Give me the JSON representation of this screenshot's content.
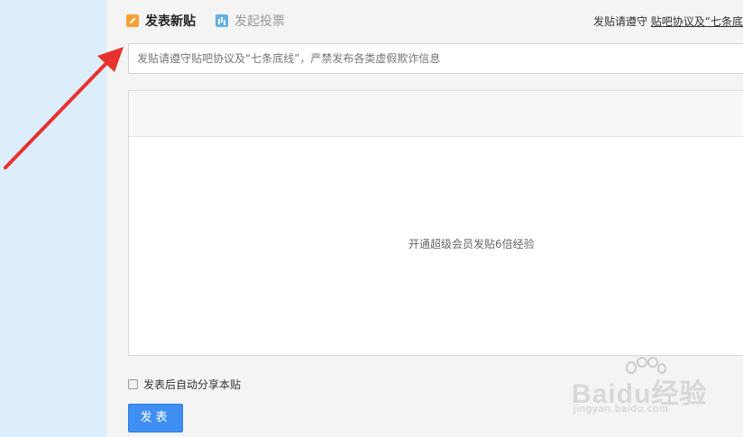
{
  "tabs": {
    "post_label": "发表新贴",
    "vote_label": "发起投票"
  },
  "notice": {
    "prefix": "发贴请遵守",
    "link_text": "贴吧协议及“七条底"
  },
  "title_input": {
    "placeholder": "发贴请遵守贴吧协议及“七条底线”，严禁发布各类虚假欺诈信息",
    "value": ""
  },
  "editor": {
    "placeholder": "开通超级会员发贴6倍经验"
  },
  "share": {
    "label": "发表后自动分享本贴",
    "checked": false
  },
  "submit": {
    "label": "发表"
  },
  "annotation": {
    "color": "#e8322d"
  },
  "watermark": {
    "brand": "Baidu经验",
    "url": "jingyan.baidu.com"
  }
}
